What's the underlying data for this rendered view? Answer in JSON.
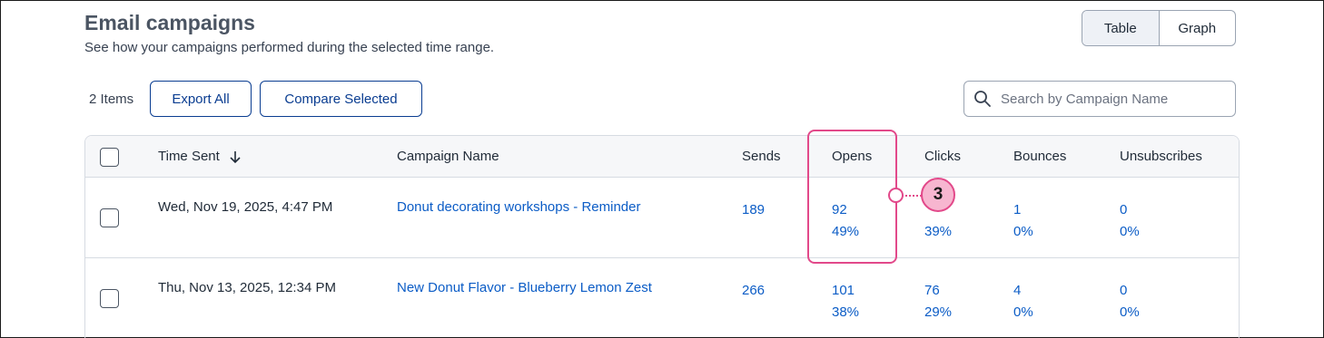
{
  "header": {
    "title": "Email campaigns",
    "subtitle": "See how your campaigns performed during the selected time range."
  },
  "view_toggle": {
    "table_label": "Table",
    "graph_label": "Graph",
    "selected": "Table"
  },
  "toolbar": {
    "items_count": "2 Items",
    "export_label": "Export All",
    "compare_label": "Compare Selected",
    "search_placeholder": "Search by Campaign Name"
  },
  "table": {
    "columns": [
      "Time Sent",
      "Campaign Name",
      "Sends",
      "Opens",
      "Clicks",
      "Bounces",
      "Unsubscribes"
    ],
    "sort_column": "Time Sent",
    "sort_direction": "descending",
    "rows": [
      {
        "time_sent": "Wed, Nov 19, 2025, 4:47 PM",
        "campaign_name": "Donut decorating workshops - Reminder",
        "sends": "189",
        "opens": "92",
        "opens_pct": "49%",
        "clicks": "",
        "clicks_pct": "39%",
        "bounces": "1",
        "bounces_pct": "0%",
        "unsubscribes": "0",
        "unsubscribes_pct": "0%"
      },
      {
        "time_sent": "Thu, Nov 13, 2025, 12:34 PM",
        "campaign_name": "New Donut Flavor - Blueberry Lemon Zest",
        "sends": "266",
        "opens": "101",
        "opens_pct": "38%",
        "clicks": "76",
        "clicks_pct": "29%",
        "bounces": "4",
        "bounces_pct": "0%",
        "unsubscribes": "0",
        "unsubscribes_pct": "0%"
      }
    ]
  },
  "callout": {
    "number": "3",
    "color": "#e2498a"
  },
  "colors": {
    "link": "#0b5cc6",
    "button": "#0a3d91",
    "highlight": "#e2498a"
  }
}
